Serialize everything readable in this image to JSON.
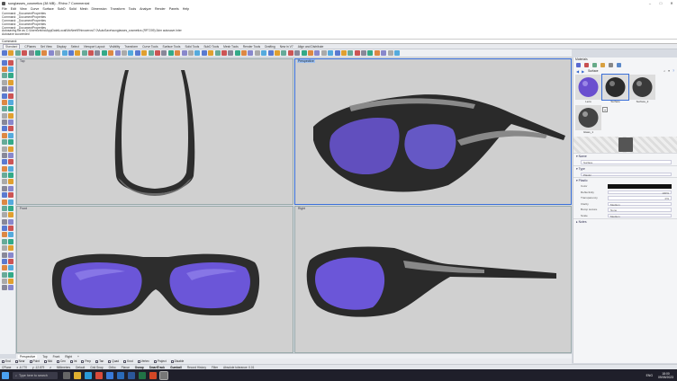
{
  "window": {
    "title": "sunglasses_cosmetics (38 MB) - Rhino 7 Commercial",
    "controls": [
      "–",
      "□",
      "✕"
    ]
  },
  "menu": [
    "File",
    "Edit",
    "View",
    "Curve",
    "Surface",
    "SubD",
    "Solid",
    "Mesh",
    "Dimension",
    "Transform",
    "Tools",
    "Analyze",
    "Render",
    "Panels",
    "Help"
  ],
  "command_history": [
    "Command: _DocumentProperties",
    "Command: _DocumentProperties",
    "Command: _DocumentProperties",
    "Command: _DocumentProperties",
    "Command: _DocumentProperties",
    "Autosaving file as C:\\Users\\rekha\\AppData\\Local\\McNeel\\Rhinoceros\\7.0\\AutoSave\\sunglasses_cosmetics (RP7209).3dm autosave.Inter",
    "Autosave succeeded",
    "Command:"
  ],
  "command_prompt": "Command:",
  "tabs": [
    "Standard",
    "CPlanes",
    "Set View",
    "Display",
    "Select",
    "Viewport Layout",
    "Visibility",
    "Transform",
    "Curve Tools",
    "Surface Tools",
    "Solid Tools",
    "SubD Tools",
    "Mesh Tools",
    "Render Tools",
    "Drafting",
    "New in V7",
    "Align and Distribute"
  ],
  "active_tab": "Standard",
  "viewports": {
    "top": "Top",
    "perspective": "Perspective",
    "front": "Front",
    "right": "Right"
  },
  "viewport_tabs": [
    "Perspective",
    "Top",
    "Front",
    "Right"
  ],
  "osnaps": [
    "End",
    "Near",
    "Point",
    "Mid",
    "Cen",
    "Int",
    "Perp",
    "Tan",
    "Quad",
    "Knot",
    "Vertex",
    "Project",
    "Disable"
  ],
  "status": {
    "cplane": "CPlane",
    "x": "x -6.770",
    "y": "y -12.879",
    "z": "z",
    "units": "Millimeters",
    "layer": "Default",
    "items": [
      "Grid Snap",
      "Ortho",
      "Planar",
      "Osnap",
      "SmartTrack",
      "Gumball",
      "Record History",
      "Filter",
      "Absolute tolerance: 0.01"
    ],
    "active": [
      "Osnap",
      "SmartTrack",
      "Gumball"
    ]
  },
  "panel": {
    "title": "Materials",
    "breadcrumb": "Surface",
    "materials": [
      {
        "name": "Lens",
        "color": "#6a4fcf"
      },
      {
        "name": "Surface",
        "color": "#2b2b2b"
      },
      {
        "name": "Surface_2",
        "color": "#3a3a3a"
      },
      {
        "name": "Glass_1",
        "color": "#444"
      }
    ],
    "name_section": "Name",
    "name_value": "Surface",
    "type_section": "Type",
    "type_value": "Plastic",
    "plastic_section": "Plastic",
    "props": [
      {
        "label": "Color",
        "value": ""
      },
      {
        "label": "Reflectivity",
        "value": "100%"
      },
      {
        "label": "Transparency",
        "value": "0%"
      },
      {
        "label": "Clarity",
        "value": "Medium"
      },
      {
        "label": "Bump texture",
        "value": "None"
      },
      {
        "label": "Scale",
        "value": "Medium"
      }
    ],
    "notes_section": "Notes"
  },
  "taskbar": {
    "search_placeholder": "Type here to search",
    "time": "18:00",
    "date": "09/05/2023",
    "lang": "ENG"
  },
  "colors": {
    "lens": "#6b56d8",
    "frame": "#2a2a2a",
    "accent": "#3a6fd8"
  }
}
